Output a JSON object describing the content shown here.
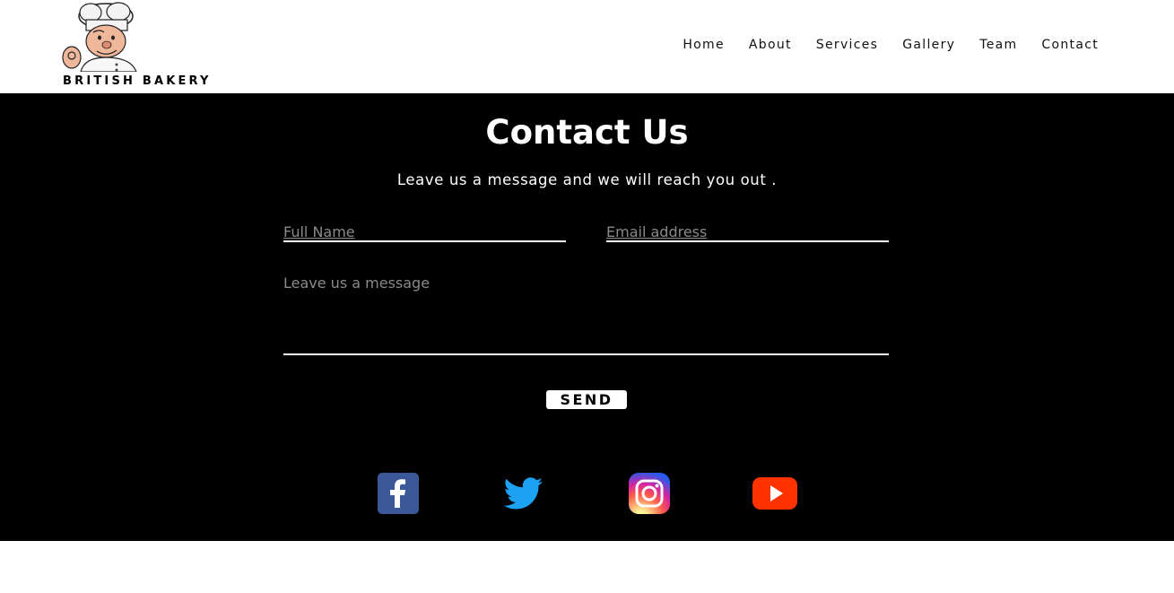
{
  "brand": {
    "name": "BRITISH BAKERY",
    "logo_icon": "chef-logo-icon"
  },
  "nav": {
    "items": [
      {
        "label": "Home"
      },
      {
        "label": "About"
      },
      {
        "label": "Services"
      },
      {
        "label": "Gallery"
      },
      {
        "label": "Team"
      },
      {
        "label": "Contact"
      }
    ]
  },
  "contact": {
    "title": "Contact Us",
    "subtitle": "Leave us a message and we will reach you out .",
    "name_placeholder": "Full Name",
    "email_placeholder": "Email address",
    "message_placeholder": "Leave us a message",
    "send_label": "SEND"
  },
  "social": {
    "icons": [
      "facebook-icon",
      "twitter-icon",
      "instagram-icon",
      "youtube-icon"
    ],
    "colors": {
      "facebook": "#3b5998",
      "twitter": "#1da1f2",
      "youtube": "#ff3300"
    }
  },
  "colors": {
    "section_bg": "#000000",
    "header_bg": "#ffffff",
    "text_light": "#ffffff",
    "placeholder": "#8a8a8a"
  }
}
